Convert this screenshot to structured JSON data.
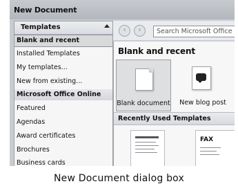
{
  "window": {
    "title": "New Document"
  },
  "sidebar": {
    "header": "Templates",
    "items": [
      {
        "label": "Blank and recent",
        "state": "selected"
      },
      {
        "label": "Installed Templates"
      },
      {
        "label": "My templates..."
      },
      {
        "label": "New from existing..."
      },
      {
        "label": "Microsoft Office Online",
        "state": "group"
      },
      {
        "label": "Featured"
      },
      {
        "label": "Agendas"
      },
      {
        "label": "Award certificates"
      },
      {
        "label": "Brochures"
      },
      {
        "label": "Business cards"
      }
    ]
  },
  "toolbar": {
    "back_icon": "back-arrow-icon",
    "forward_icon": "forward-arrow-icon",
    "search_placeholder": "Search Microsoft Office"
  },
  "main": {
    "section_title": "Blank and recent",
    "tiles": [
      {
        "label": "Blank document",
        "icon": "blank-document-icon",
        "selected": true
      },
      {
        "label": "New blog post",
        "icon": "blog-post-icon",
        "selected": false
      }
    ],
    "recent_header": "Recently Used Templates",
    "recent_thumbs": [
      {
        "text": ""
      },
      {
        "text": "FAX"
      }
    ]
  },
  "caption": "New Document dialog box"
}
